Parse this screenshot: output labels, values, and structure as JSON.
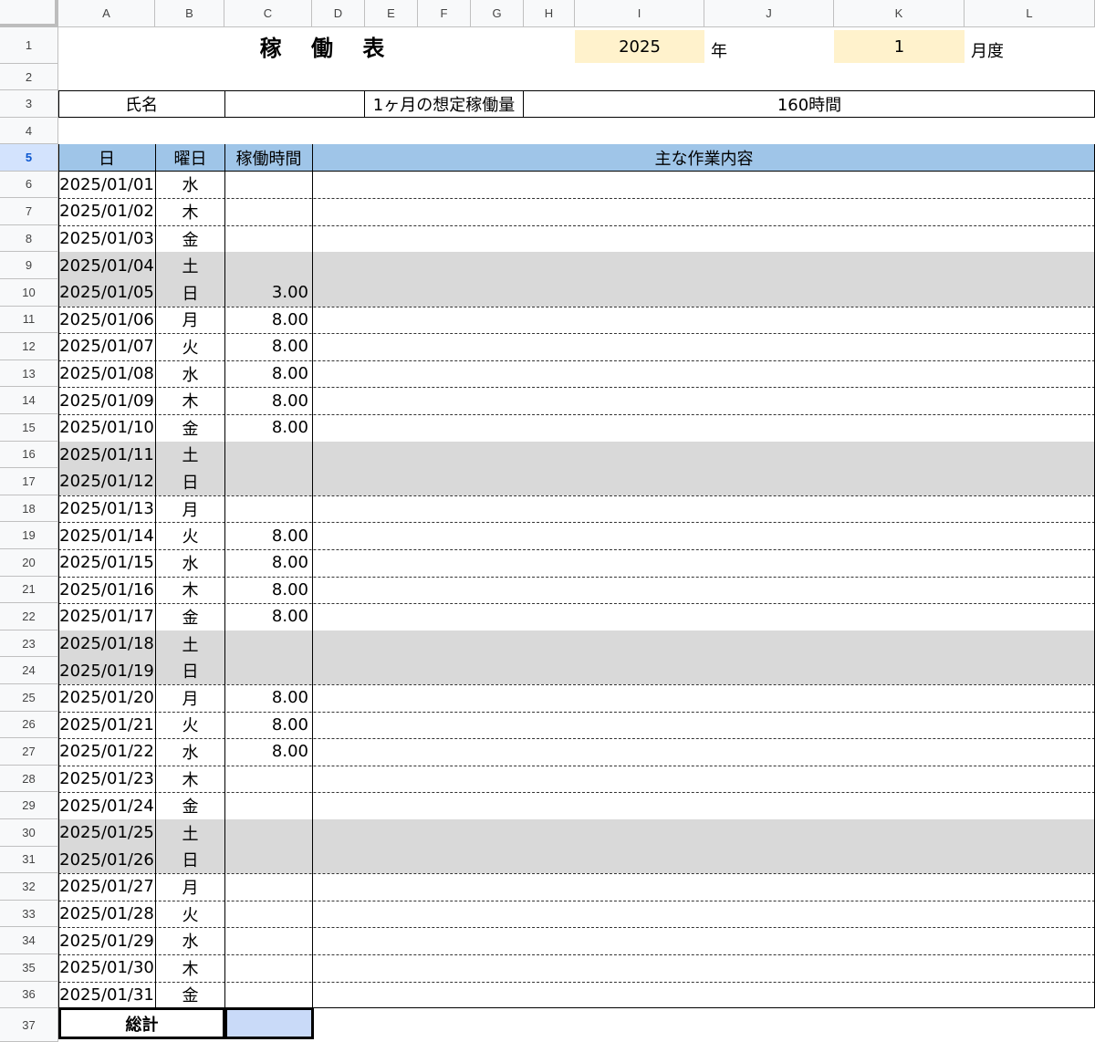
{
  "column_headers": [
    "A",
    "B",
    "C",
    "D",
    "E",
    "F",
    "G",
    "H",
    "I",
    "J",
    "K",
    "L"
  ],
  "row_numbers": [
    "1",
    "2",
    "3",
    "4",
    "5",
    "6",
    "7",
    "8",
    "9",
    "10",
    "11",
    "12",
    "13",
    "14",
    "15",
    "16",
    "17",
    "18",
    "19",
    "20",
    "21",
    "22",
    "23",
    "24",
    "25",
    "26",
    "27",
    "28",
    "29",
    "30",
    "31",
    "32",
    "33",
    "34",
    "35",
    "36",
    "37"
  ],
  "active_row": "5",
  "title": "稼 働 表",
  "year_value": "2025",
  "year_label": "年",
  "month_value": "1",
  "month_label": "月度",
  "name_label": "氏名",
  "name_value": "",
  "expected_label": "1ヶ月の想定稼働量",
  "expected_value": "160時間",
  "table_headers": {
    "date": "日",
    "weekday": "曜日",
    "hours": "稼働時間",
    "content": "主な作業内容"
  },
  "colors": {
    "header_band": "#9fc5e8",
    "weekend_band": "#d9d9d9",
    "input_yellow": "#fff2cc",
    "total_value_blue": "#c9daf8"
  },
  "rows": [
    {
      "date": "2025/01/01",
      "weekday": "水",
      "hours": "",
      "weekend": false
    },
    {
      "date": "2025/01/02",
      "weekday": "木",
      "hours": "",
      "weekend": false
    },
    {
      "date": "2025/01/03",
      "weekday": "金",
      "hours": "",
      "weekend": false
    },
    {
      "date": "2025/01/04",
      "weekday": "土",
      "hours": "",
      "weekend": true
    },
    {
      "date": "2025/01/05",
      "weekday": "日",
      "hours": "3.00",
      "weekend": true
    },
    {
      "date": "2025/01/06",
      "weekday": "月",
      "hours": "8.00",
      "weekend": false
    },
    {
      "date": "2025/01/07",
      "weekday": "火",
      "hours": "8.00",
      "weekend": false
    },
    {
      "date": "2025/01/08",
      "weekday": "水",
      "hours": "8.00",
      "weekend": false
    },
    {
      "date": "2025/01/09",
      "weekday": "木",
      "hours": "8.00",
      "weekend": false
    },
    {
      "date": "2025/01/10",
      "weekday": "金",
      "hours": "8.00",
      "weekend": false
    },
    {
      "date": "2025/01/11",
      "weekday": "土",
      "hours": "",
      "weekend": true
    },
    {
      "date": "2025/01/12",
      "weekday": "日",
      "hours": "",
      "weekend": true
    },
    {
      "date": "2025/01/13",
      "weekday": "月",
      "hours": "",
      "weekend": false
    },
    {
      "date": "2025/01/14",
      "weekday": "火",
      "hours": "8.00",
      "weekend": false
    },
    {
      "date": "2025/01/15",
      "weekday": "水",
      "hours": "8.00",
      "weekend": false
    },
    {
      "date": "2025/01/16",
      "weekday": "木",
      "hours": "8.00",
      "weekend": false
    },
    {
      "date": "2025/01/17",
      "weekday": "金",
      "hours": "8.00",
      "weekend": false
    },
    {
      "date": "2025/01/18",
      "weekday": "土",
      "hours": "",
      "weekend": true
    },
    {
      "date": "2025/01/19",
      "weekday": "日",
      "hours": "",
      "weekend": true
    },
    {
      "date": "2025/01/20",
      "weekday": "月",
      "hours": "8.00",
      "weekend": false
    },
    {
      "date": "2025/01/21",
      "weekday": "火",
      "hours": "8.00",
      "weekend": false
    },
    {
      "date": "2025/01/22",
      "weekday": "水",
      "hours": "8.00",
      "weekend": false
    },
    {
      "date": "2025/01/23",
      "weekday": "木",
      "hours": "",
      "weekend": false
    },
    {
      "date": "2025/01/24",
      "weekday": "金",
      "hours": "",
      "weekend": false
    },
    {
      "date": "2025/01/25",
      "weekday": "土",
      "hours": "",
      "weekend": true
    },
    {
      "date": "2025/01/26",
      "weekday": "日",
      "hours": "",
      "weekend": true
    },
    {
      "date": "2025/01/27",
      "weekday": "月",
      "hours": "",
      "weekend": false
    },
    {
      "date": "2025/01/28",
      "weekday": "火",
      "hours": "",
      "weekend": false
    },
    {
      "date": "2025/01/29",
      "weekday": "水",
      "hours": "",
      "weekend": false
    },
    {
      "date": "2025/01/30",
      "weekday": "木",
      "hours": "",
      "weekend": false
    },
    {
      "date": "2025/01/31",
      "weekday": "金",
      "hours": "",
      "weekend": false
    }
  ],
  "total_label": "総計",
  "total_value": ""
}
